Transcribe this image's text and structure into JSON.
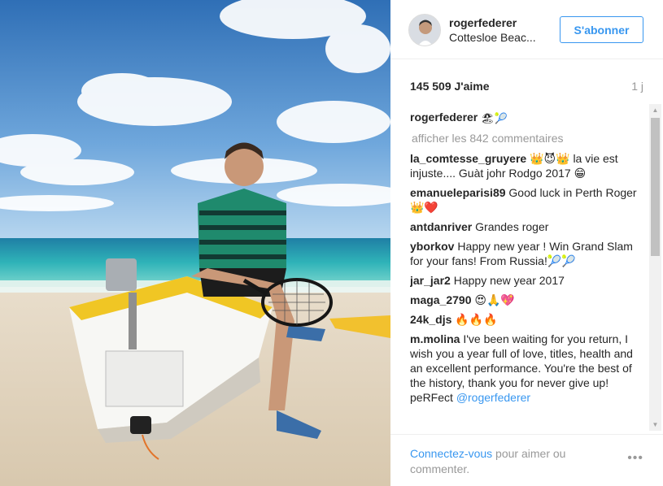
{
  "post": {
    "username": "rogerfederer",
    "location": "Cottesloe Beac...",
    "follow_label": "S'abonner",
    "likes": "145 509 J'aime",
    "time_ago": "1 j"
  },
  "caption": {
    "username": "rogerfederer",
    "text": "🏖🎾"
  },
  "load_more": "afficher les 842 commentaires",
  "comments": [
    {
      "username": "la_comtesse_gruyere",
      "text": "👑😈👑 la vie est injuste.... Guàt johr Rodgo 2017 😁"
    },
    {
      "username": "emanueleparisi89",
      "text": "Good luck in Perth Roger👑❤️"
    },
    {
      "username": "antdanriver",
      "text": "Grandes roger"
    },
    {
      "username": "yborkov",
      "text": "Happy new year ! Win Grand Slam for your fans! From Russia!🎾🎾"
    },
    {
      "username": "jar_jar2",
      "text": "Happy new year 2017"
    },
    {
      "username": "maga_2790",
      "text": "😍🙏💖"
    },
    {
      "username": "24k_djs",
      "text": "🔥🔥🔥"
    },
    {
      "username": "m.molina",
      "text": "I've been waiting for you return, I wish you a year full of love, titles, health and an excellent performance. You're the best of the history, thank you for never give up! peRFect",
      "mention": "@rogerfederer"
    }
  ],
  "footer": {
    "login_link": "Connectez-vous",
    "login_rest": " pour aimer ou commenter.",
    "more_icon": "•••"
  },
  "colors": {
    "accent": "#3897f0",
    "muted": "#999999",
    "text": "#262626"
  }
}
